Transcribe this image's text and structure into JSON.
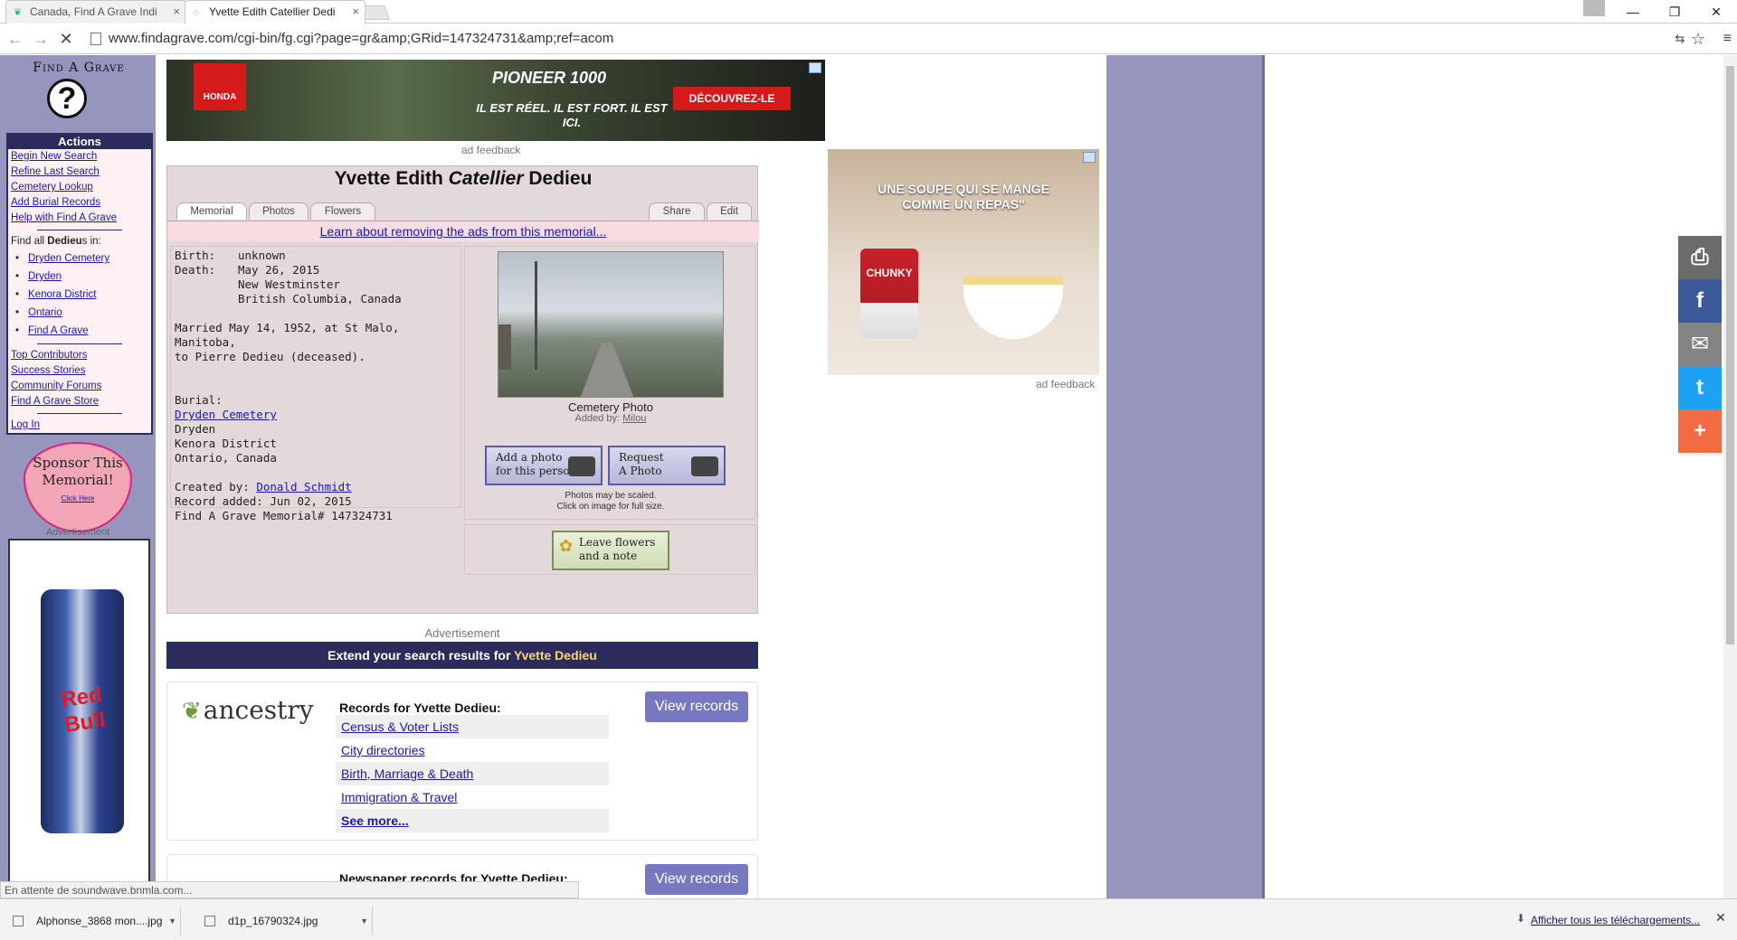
{
  "browser": {
    "tabs": [
      {
        "title": "Canada, Find A Grave Indi",
        "icon": "ancestry-leaf-icon"
      },
      {
        "title": "Yvette Edith Catellier Dedi",
        "icon": "loading-spinner-icon"
      }
    ],
    "url": "www.findagrave.com/cgi-bin/fg.cgi?page=gr&amp;GRid=147324731&amp;ref=acom",
    "status": "En attente de soundwave.bnmla.com...",
    "downloads": [
      "Alphonse_3868 mon....jpg",
      "d1p_16790324.jpg"
    ],
    "show_all_downloads": "Afficher tous les téléchargements..."
  },
  "sidebar": {
    "logo": "Find A Grave",
    "actions_title": "Actions",
    "actions": [
      "Begin New Search",
      "Refine Last Search",
      "Cemetery Lookup",
      "Add Burial Records",
      "Help with Find A Grave"
    ],
    "find_all_prefix": "Find all ",
    "find_all_name": "Dedieu",
    "find_all_suffix": "s in:",
    "find_all_links": [
      "Dryden Cemetery",
      "Dryden",
      "Kenora District",
      "Ontario",
      "Find A Grave"
    ],
    "community": [
      "Top Contributors",
      "Success Stories",
      "Community Forums",
      "Find A Grave Store"
    ],
    "login": "Log In",
    "sponsor_text": "Sponsor This Memorial!",
    "sponsor_click": "Click Here",
    "ad_label": "Advertisement",
    "side_ad_text": "Red Bull"
  },
  "top_ad": {
    "brand": "HONDA",
    "headline": "PIONEER 1000",
    "tagline": "IL EST RÉEL. IL EST FORT. IL EST ICI.",
    "cta": "DÉCOUVREZ-LE",
    "feedback": "ad feedback"
  },
  "memorial": {
    "first_names": "Yvette Edith",
    "maiden_name": "Catellier",
    "last_name": "Dedieu",
    "tabs": [
      "Memorial",
      "Photos",
      "Flowers"
    ],
    "right_tabs": [
      "Share",
      "Edit"
    ],
    "remove_ads_link": "Learn about removing the ads from this memorial...",
    "birth_label": "Birth:",
    "birth_value": "unknown",
    "death_label": "Death:",
    "death_date": "May 26, 2015",
    "death_place_1": "New Westminster",
    "death_place_2": "British Columbia, Canada",
    "marriage_line_1": "Married May 14, 1952, at St Malo, Manitoba,",
    "marriage_line_2": "to Pierre Dedieu (deceased).",
    "burial_label": "Burial:",
    "burial_cemetery": "Dryden Cemetery",
    "burial_city": "Dryden",
    "burial_district": "Kenora District",
    "burial_province": "Ontario, Canada",
    "created_by_label": "Created by: ",
    "created_by": "Donald Schmidt",
    "record_added": "Record added: Jun 02, 2015",
    "memorial_number": "Find A Grave Memorial# 147324731",
    "photo_caption": "Cemetery Photo",
    "photo_added_label": "Added by: ",
    "photo_added_by": "Milou",
    "add_photo_btn_1": "Add a photo",
    "add_photo_btn_2": "for this person",
    "request_photo_btn_1": "Request",
    "request_photo_btn_2": "A Photo",
    "photo_note_1": "Photos may be scaled.",
    "photo_note_2": "Click on image for full size.",
    "flowers_btn_1": "Leave flowers",
    "flowers_btn_2": "and a note"
  },
  "right_ad": {
    "headline_1": "UNE SOUPE QUI SE MANGE",
    "headline_2": "COMME UN REPAS\"",
    "product": "CHUNKY",
    "feedback": "ad feedback"
  },
  "extend": {
    "ad_label": "Advertisement",
    "title_prefix": "Extend your search results for ",
    "title_name": "Yvette Dedieu",
    "ancestry_logo": "ancestry",
    "records_title": "Records for Yvette Dedieu:",
    "record_links": [
      "Census & Voter Lists",
      "City directories",
      "Birth, Marriage & Death",
      "Immigration & Travel",
      "See more..."
    ],
    "view_records": "View records",
    "newspaper_title": "Newspaper records for Yvette Dedieu:"
  },
  "share_bar": [
    {
      "icon": "print-icon",
      "glyph": "⎙",
      "color": "#6b6b6b"
    },
    {
      "icon": "facebook-icon",
      "glyph": "f",
      "color": "#3b5998"
    },
    {
      "icon": "email-icon",
      "glyph": "✉",
      "color": "#848484"
    },
    {
      "icon": "twitter-icon",
      "glyph": "t",
      "color": "#1da1f2"
    },
    {
      "icon": "more-icon",
      "glyph": "+",
      "color": "#f26b43"
    }
  ]
}
